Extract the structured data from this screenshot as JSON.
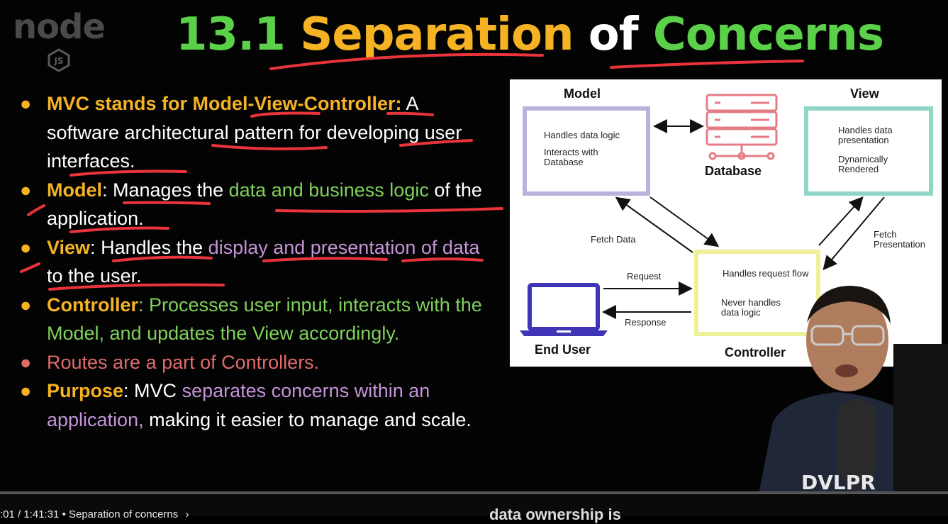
{
  "logo": {
    "word": "node",
    "badge": "JS"
  },
  "title": {
    "number": "13.1",
    "word1": "Separation",
    "word2": "of",
    "word3": "Concerns"
  },
  "bullets": {
    "b1": {
      "key": "MVC stands for Model-View-Controller",
      "colon": ":",
      "rest": " A software architectural pattern for developing user interfaces."
    },
    "b2": {
      "key": "Model",
      "colon": ":",
      "t1": " Manages the ",
      "t2": "data and business logic",
      "t3": " of the application."
    },
    "b3": {
      "key": "View",
      "colon": ":",
      "t1": " Handles the ",
      "t2": "display and presentation of data",
      "t3": " to the user."
    },
    "b4": {
      "key": "Controller",
      "colon": ":",
      "t1": " Processes user input, interacts with the Model, and updates the View accordingly."
    },
    "b5": {
      "text": "Routes are a part of Controllers."
    },
    "b6": {
      "key": "Purpose",
      "colon": ":",
      "t1": " MVC ",
      "t2": "separates concerns within an application,",
      "t3": " making it easier to manage and scale."
    }
  },
  "diagram": {
    "model_label": "Model",
    "view_label": "View",
    "database_label": "Database",
    "controller_label": "Controller",
    "enduser_label": "End User",
    "model_text1": "Handles data logic",
    "model_text2": "Interacts with Database",
    "view_text1": "Handles data presentation",
    "view_text2": "Dynamically Rendered",
    "ctrl_text1": "Handles request flow",
    "ctrl_text2": "Never handles data logic",
    "fetch_data": "Fetch Data",
    "fetch_presentation": "Fetch Presentation",
    "request": "Request",
    "response": "Response"
  },
  "presenter": {
    "shirt_text": "DVLPR"
  },
  "player": {
    "time": ":01 / 1:41:31",
    "chapter": "• Separation of concerns",
    "caption": "data ownership is"
  },
  "colors": {
    "green": "#5bd14a",
    "orange": "#f5b324",
    "purple": "#c593d8",
    "pink": "#e06b6b",
    "underline": "#e8343a"
  }
}
